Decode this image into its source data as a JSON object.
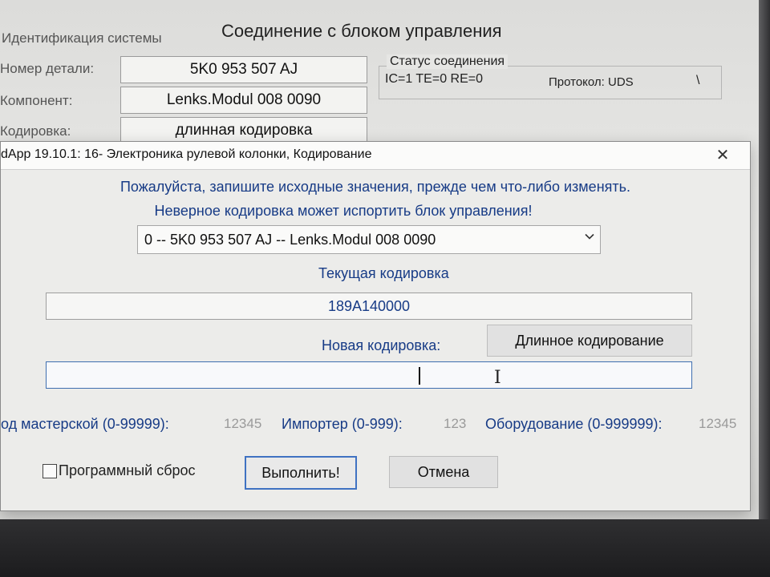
{
  "background_window": {
    "title": "Соединение с блоком управления",
    "group_label": "Идентификация системы",
    "rows": [
      {
        "label": "Номер детали:",
        "value": "5K0 953 507 AJ"
      },
      {
        "label": "Компонент:",
        "value": "Lenks.Modul   008 0090"
      },
      {
        "label": "Кодировка:",
        "value": "длинная кодировка"
      }
    ],
    "status": {
      "legend": "Статус соединения",
      "text": "IC=1  TE=0   RE=0",
      "protocol": "Протокол: UDS",
      "spinner": "\\"
    }
  },
  "dialog": {
    "title": "dApp 19.10.1: 16- Электроника рулевой колонки,  Кодирование",
    "close_glyph": "✕",
    "warning_line1": "Пожалуйста, запишите исходные значения, прежде чем что-либо изменять.",
    "warning_line2": "Неверное кодировка может испортить блок управления!",
    "module_select": "0 -- 5K0 953 507 AJ -- Lenks.Modul   008 0090",
    "current_coding_label": "Текущая кодировка",
    "current_coding_value": "189A140000",
    "new_coding_label": "Новая кодировка:",
    "new_coding_value": "",
    "long_coding_button": "Длинное кодирование",
    "workshop_label": "од мастерской (0-99999):",
    "workshop_value": "12345",
    "importer_label": "Импортер (0-999):",
    "importer_value": "123",
    "equipment_label": "Оборудование (0-999999):",
    "equipment_value": "12345",
    "soft_reset_label": "Программный сброс",
    "soft_reset_checked": false,
    "execute_button": "Выполнить!",
    "cancel_button": "Отмена"
  },
  "colors": {
    "label_blue": "#173b86",
    "default_button_border": "#3f72c2"
  }
}
